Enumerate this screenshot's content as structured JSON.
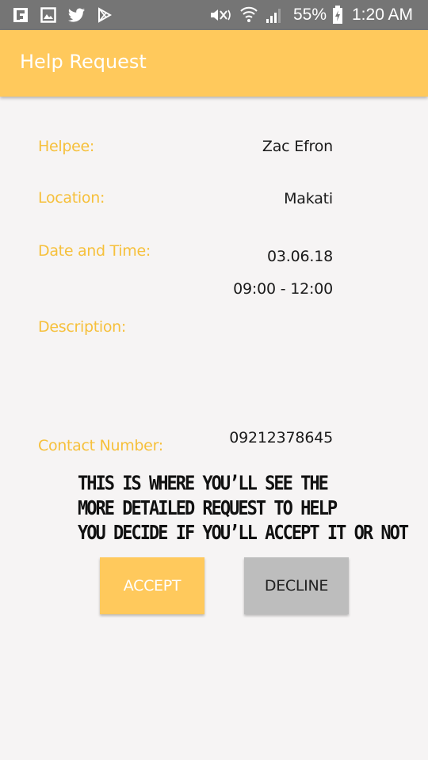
{
  "status_bar": {
    "icons": [
      "flipboard-icon",
      "gallery-icon",
      "twitter-icon",
      "play-store-icon",
      "mute-icon",
      "wifi-icon",
      "signal-icon",
      "battery-icon"
    ],
    "battery": "55%",
    "time": "1:20 AM"
  },
  "app_bar": {
    "title": "Help Request"
  },
  "details": {
    "helpee_label": "Helpee:",
    "helpee_value": "Zac Efron",
    "location_label": "Location:",
    "location_value": "Makati",
    "datetime_label": "Date and Time:",
    "date_value": "03.06.18",
    "time_value": "09:00 - 12:00",
    "description_label": "Description:",
    "description_value": "",
    "contact_label": "Contact Number:",
    "contact_value": "09212378645"
  },
  "note": {
    "line1": "THIS IS WHERE YOU’LL SEE THE",
    "line2": "MORE DETAILED REQUEST TO HELP",
    "line3": "YOU DECIDE IF YOU’LL ACCEPT IT OR NOT"
  },
  "actions": {
    "accept_label": "ACCEPT",
    "decline_label": "DECLINE"
  },
  "colors": {
    "accent": "#ffc95c",
    "label": "#f6c03b",
    "status_bar": "#757575",
    "decline": "#bdbdbd"
  }
}
